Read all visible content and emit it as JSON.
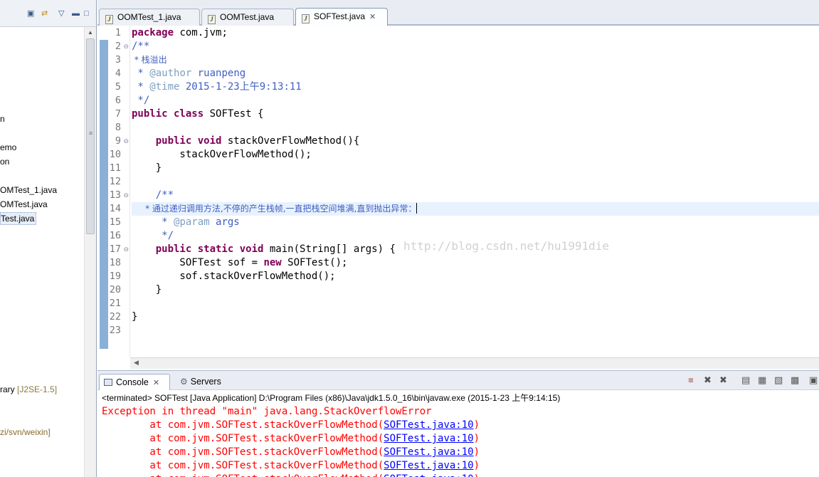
{
  "explorer": {
    "items": [
      {
        "text": "n"
      },
      {
        "text": "emo"
      },
      {
        "text": "on"
      },
      {
        "text": "OMTest_1.java"
      },
      {
        "text": "OMTest.java"
      },
      {
        "text": "Test.java"
      },
      {
        "text": "rary ",
        "suffix": "[J2SE-1.5]"
      },
      {
        "text": "zi/svn/weixin]"
      }
    ]
  },
  "editor": {
    "tabs": [
      {
        "label": "OOMTest_1.java"
      },
      {
        "label": "OOMTest.java"
      },
      {
        "label": "SOFTest.java",
        "active": true
      }
    ],
    "watermark": "http://blog.csdn.net/hu1991die",
    "lines": [
      {
        "n": "1"
      },
      {
        "n": "2",
        "fold": true
      },
      {
        "n": "3"
      },
      {
        "n": "4"
      },
      {
        "n": "5"
      },
      {
        "n": "6"
      },
      {
        "n": "7"
      },
      {
        "n": "8"
      },
      {
        "n": "9",
        "fold": true
      },
      {
        "n": "10"
      },
      {
        "n": "11"
      },
      {
        "n": "12"
      },
      {
        "n": "13",
        "fold": true
      },
      {
        "n": "14"
      },
      {
        "n": "15"
      },
      {
        "n": "16"
      },
      {
        "n": "17",
        "fold": true
      },
      {
        "n": "18"
      },
      {
        "n": "19"
      },
      {
        "n": "20"
      },
      {
        "n": "21"
      },
      {
        "n": "22"
      },
      {
        "n": "23"
      }
    ],
    "code": {
      "l1_kw": "package",
      "l1_rest": " com.jvm;",
      "l2": "/**",
      "l3": " * 栈溢出",
      "l4_star": " * ",
      "l4_tag": "@author",
      "l4_rest": " ruanpeng",
      "l5_star": " * ",
      "l5_tag": "@time",
      "l5_rest": " 2015-1-23上午9:13:11",
      "l6": " */",
      "l7_kw": "public class",
      "l7_rest": " SOFTest {",
      "l9_indent": "    ",
      "l9_kw": "public void",
      "l9_rest": " stackOverFlowMethod(){",
      "l10": "        stackOverFlowMethod();",
      "l11": "    }",
      "l13": "    /**",
      "l14": "     * 通过递归调用方法,不停的产生栈帧,一直把栈空间堆满,直到抛出异常：",
      "l15_star": "     * ",
      "l15_tag": "@param",
      "l15_rest": " args",
      "l16": "     */",
      "l17_indent": "    ",
      "l17_kw": "public static void",
      "l17_rest": " main(String[] args) {",
      "l18_a": "        SOFTest sof = ",
      "l18_kw": "new",
      "l18_b": " SOFTest();",
      "l19": "        sof.stackOverFlowMethod();",
      "l20": "    }",
      "l22": "}"
    }
  },
  "console": {
    "tabs": [
      {
        "label": "Console"
      },
      {
        "label": "Servers"
      }
    ],
    "status": "<terminated> SOFTest [Java Application] D:\\Program Files (x86)\\Java\\jdk1.5.0_16\\bin\\javaw.exe (2015-1-23 上午9:14:15)",
    "exception": "Exception in thread \"main\" java.lang.StackOverflowError",
    "trace_prefix": "        at com.jvm.SOFTest.stackOverFlowMethod(",
    "trace_link": "SOFTest.java:10",
    "trace_suffix": ")"
  },
  "colors": {
    "keyword": "#7f0055",
    "javadoc": "#3f5fbf",
    "javadoc_tag": "#7f9fbf",
    "console_error": "#ff0000",
    "console_link": "#0000ff",
    "current_line": "#e8f2fe"
  }
}
